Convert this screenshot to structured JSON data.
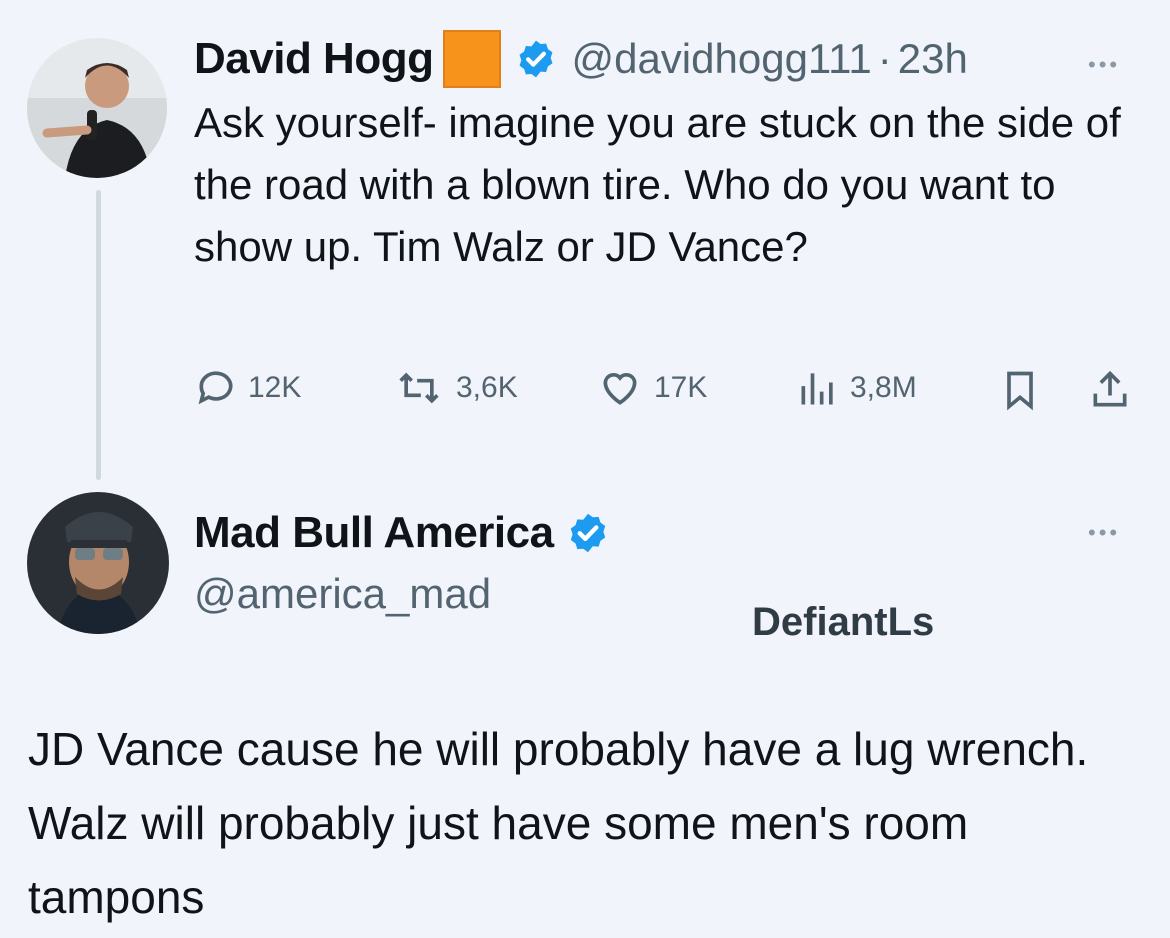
{
  "tweet": {
    "author_name": "David Hogg",
    "author_handle": "@davidhogg111",
    "separator": "·",
    "time": "23h",
    "text": "Ask yourself- imagine you are stuck on the side of the road with a blown tire. Who do you want to show up. Tim Walz or JD Vance?",
    "stats": {
      "replies": "12K",
      "reposts": "3,6K",
      "likes": "17K",
      "views": "3,8M"
    },
    "badge_color": "#f7931a",
    "verified_color": "#1d9bf0"
  },
  "reply": {
    "author_name": "Mad Bull America",
    "author_handle": "@america_mad",
    "text": "JD Vance cause he will probably have a lug wrench. Walz will probably just have some men's room tampons"
  },
  "watermark": "DefiantLs"
}
